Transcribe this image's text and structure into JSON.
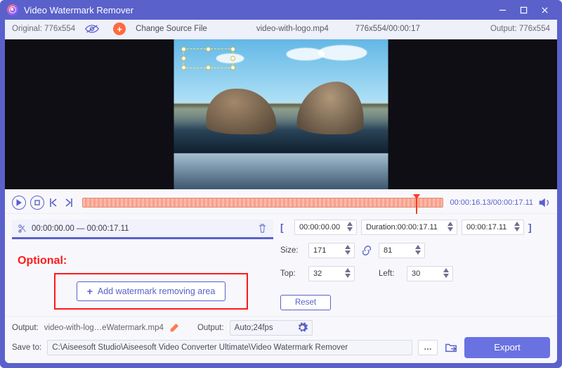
{
  "window": {
    "title": "Video Watermark Remover"
  },
  "infobar": {
    "original_label": "Original:",
    "original_dims": "776x554",
    "change_src": "Change Source File",
    "filename": "video-with-logo.mp4",
    "src_dims_time": "776x554/00:00:17",
    "output_label": "Output:",
    "output_dims": "776x554"
  },
  "playback": {
    "current_time": "00:00:16.13",
    "total_time": "00:00:17.11"
  },
  "segment": {
    "start_label": "00:00:00.00",
    "sep": "—",
    "end_label": "00:00:17.11"
  },
  "optional_lbl": "Optional:",
  "add_area_label": "Add watermark removing area",
  "rp": {
    "clip_start": "00:00:00.00",
    "duration_label": "Duration:00:00:17.11",
    "clip_end": "00:00:17.11",
    "size_label": "Size:",
    "width": "171",
    "height": "81",
    "top_label": "Top:",
    "top": "32",
    "left_label": "Left:",
    "left": "30",
    "reset": "Reset"
  },
  "output": {
    "label": "Output:",
    "filename": "video-with-log…eWatermark.mp4",
    "fmt_label": "Output:",
    "fmt": "Auto;24fps"
  },
  "save": {
    "label": "Save to:",
    "path": "C:\\Aiseesoft Studio\\Aiseesoft Video Converter Ultimate\\Video Watermark Remover"
  },
  "export_label": "Export"
}
